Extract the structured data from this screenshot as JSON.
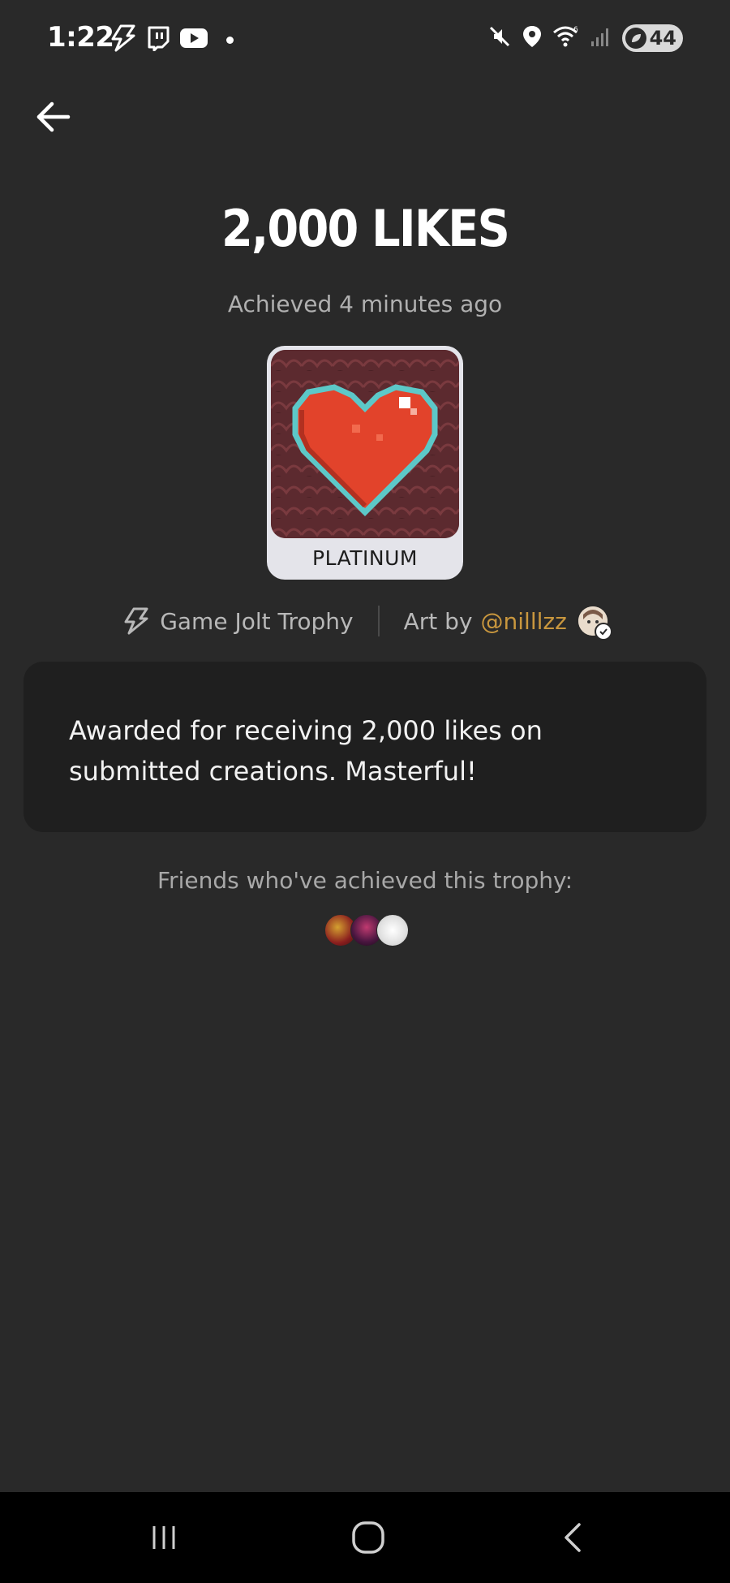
{
  "status_bar": {
    "time": "1:22",
    "battery": "44",
    "left_icons": [
      "gamejolt-icon",
      "twitch-icon",
      "youtube-icon",
      "dot"
    ],
    "right_icons": [
      "mute-icon",
      "location-icon",
      "wifi-icon",
      "signal-icon",
      "battery-icon"
    ]
  },
  "trophy": {
    "title": "2,000 LIKES",
    "achieved": "Achieved 4 minutes ago",
    "tier": "PLATINUM",
    "source": "Game Jolt Trophy",
    "art_by_label": "Art by",
    "artist": "@nilllzz",
    "description": "Awarded for receiving 2,000 likes on submitted creations. Masterful!"
  },
  "friends": {
    "label": "Friends who've achieved this trophy:"
  },
  "colors": {
    "background": "#292929",
    "card": "#1f1f1f",
    "accent": "#c9973e",
    "muted_text": "#b0b0b0"
  }
}
